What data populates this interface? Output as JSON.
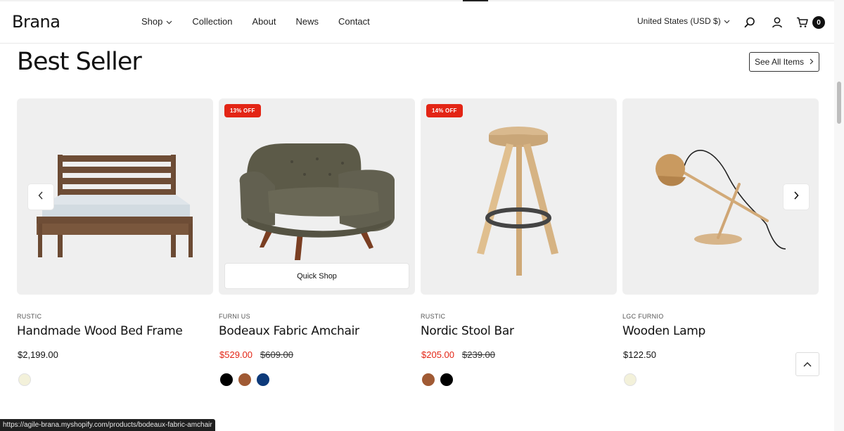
{
  "header": {
    "logo": "Brana",
    "nav": [
      {
        "label": "Shop",
        "has_dropdown": true
      },
      {
        "label": "Collection"
      },
      {
        "label": "About"
      },
      {
        "label": "News"
      },
      {
        "label": "Contact"
      }
    ],
    "currency": "United States (USD $)",
    "cart_count": "0",
    "icons": [
      "search-icon",
      "account-icon",
      "cart-icon"
    ]
  },
  "section": {
    "title": "Best Seller",
    "see_all_label": "See All Items"
  },
  "products": [
    {
      "vendor": "RUSTIC",
      "title": "Handmade Wood Bed Frame",
      "price": "$2,199.00",
      "compare_price": "",
      "on_sale": false,
      "badge": "",
      "swatches": [
        "#f3f1da"
      ]
    },
    {
      "vendor": "FURNI US",
      "title": "Bodeaux Fabric Amchair",
      "price": "$529.00",
      "compare_price": "$609.00",
      "on_sale": true,
      "badge": "13% OFF",
      "quick_shop": "Quick Shop",
      "swatches": [
        "#000000",
        "#a05a34",
        "#0d3a7a"
      ]
    },
    {
      "vendor": "RUSTIC",
      "title": "Nordic Stool Bar",
      "price": "$205.00",
      "compare_price": "$239.00",
      "on_sale": true,
      "badge": "14% OFF",
      "swatches": [
        "#a05a34",
        "#000000"
      ]
    },
    {
      "vendor": "LGC FURNIO",
      "title": "Wooden Lamp",
      "price": "$122.50",
      "compare_price": "",
      "on_sale": false,
      "badge": "",
      "swatches": [
        "#f3f1da"
      ]
    }
  ],
  "status_bar": {
    "url": "https://agile-brana.myshopify.com/products/bodeaux-fabric-amchair"
  },
  "colors": {
    "sale": "#e32515",
    "card_bg": "#efefef",
    "text": "#111111"
  }
}
